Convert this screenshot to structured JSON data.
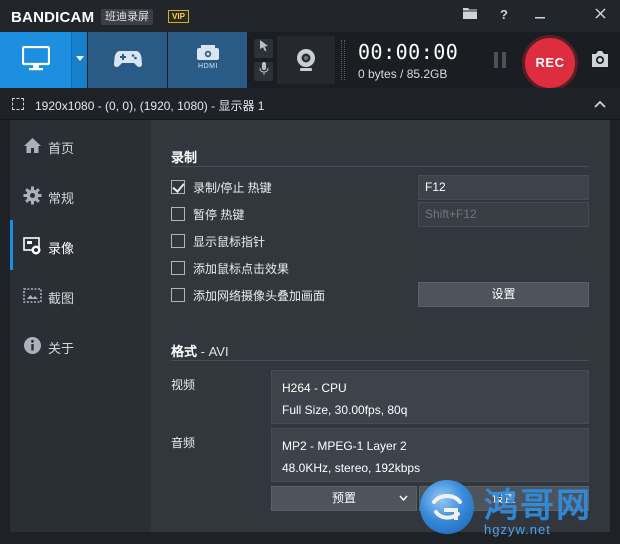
{
  "app": {
    "brand_left": "BANDI",
    "brand_right": "CAM",
    "brand_cn": "班迪录屏",
    "vip": "VIP"
  },
  "titlebar_icons": [
    "folder-icon",
    "help-icon",
    "minimize-icon",
    "close-icon"
  ],
  "toolbar": {
    "modes": [
      "screen-mode",
      "game-mode",
      "hdmi-mode"
    ],
    "hdmi_label": "HDMI",
    "timer": "00:00:00",
    "bytes": "0 bytes / 85.2GB",
    "rec_label": "REC"
  },
  "selection": {
    "text": "1920x1080 - (0, 0), (1920, 1080) - 显示器 1"
  },
  "sidebar": {
    "items": [
      {
        "label": "首页",
        "icon": "home-icon"
      },
      {
        "label": "常规",
        "icon": "gear-icon"
      },
      {
        "label": "录像",
        "icon": "video-record-icon"
      },
      {
        "label": "截图",
        "icon": "image-icon"
      },
      {
        "label": "关于",
        "icon": "info-icon"
      }
    ],
    "active_index": 2
  },
  "record": {
    "title": "录制",
    "options": [
      {
        "label": "录制/停止 热键",
        "checked": true
      },
      {
        "label": "暂停 热键",
        "checked": false
      },
      {
        "label": "显示鼠标指针",
        "checked": false
      },
      {
        "label": "添加鼠标点击效果",
        "checked": false
      },
      {
        "label": "添加网络摄像头叠加画面",
        "checked": false
      }
    ],
    "hotkey_record": "F12",
    "hotkey_pause": "Shift+F12",
    "settings_button": "设置"
  },
  "format": {
    "title": "格式",
    "format_name": "- AVI",
    "video_label": "视频",
    "video_line1": "H264 - CPU",
    "video_line2": "Full Size, 30.00fps, 80q",
    "audio_label": "音频",
    "audio_line1": "MP2 - MPEG-1 Layer 2",
    "audio_line2": "48.0KHz, stereo, 192kbps",
    "preset_button": "预置",
    "settings_button_partial": "设置"
  },
  "watermark": {
    "text": "鸿哥网",
    "url": "hgzyw.net"
  },
  "colors": {
    "accent": "#1d8fe0",
    "rec": "#dd2d3f",
    "vip": "#ffd23a"
  }
}
